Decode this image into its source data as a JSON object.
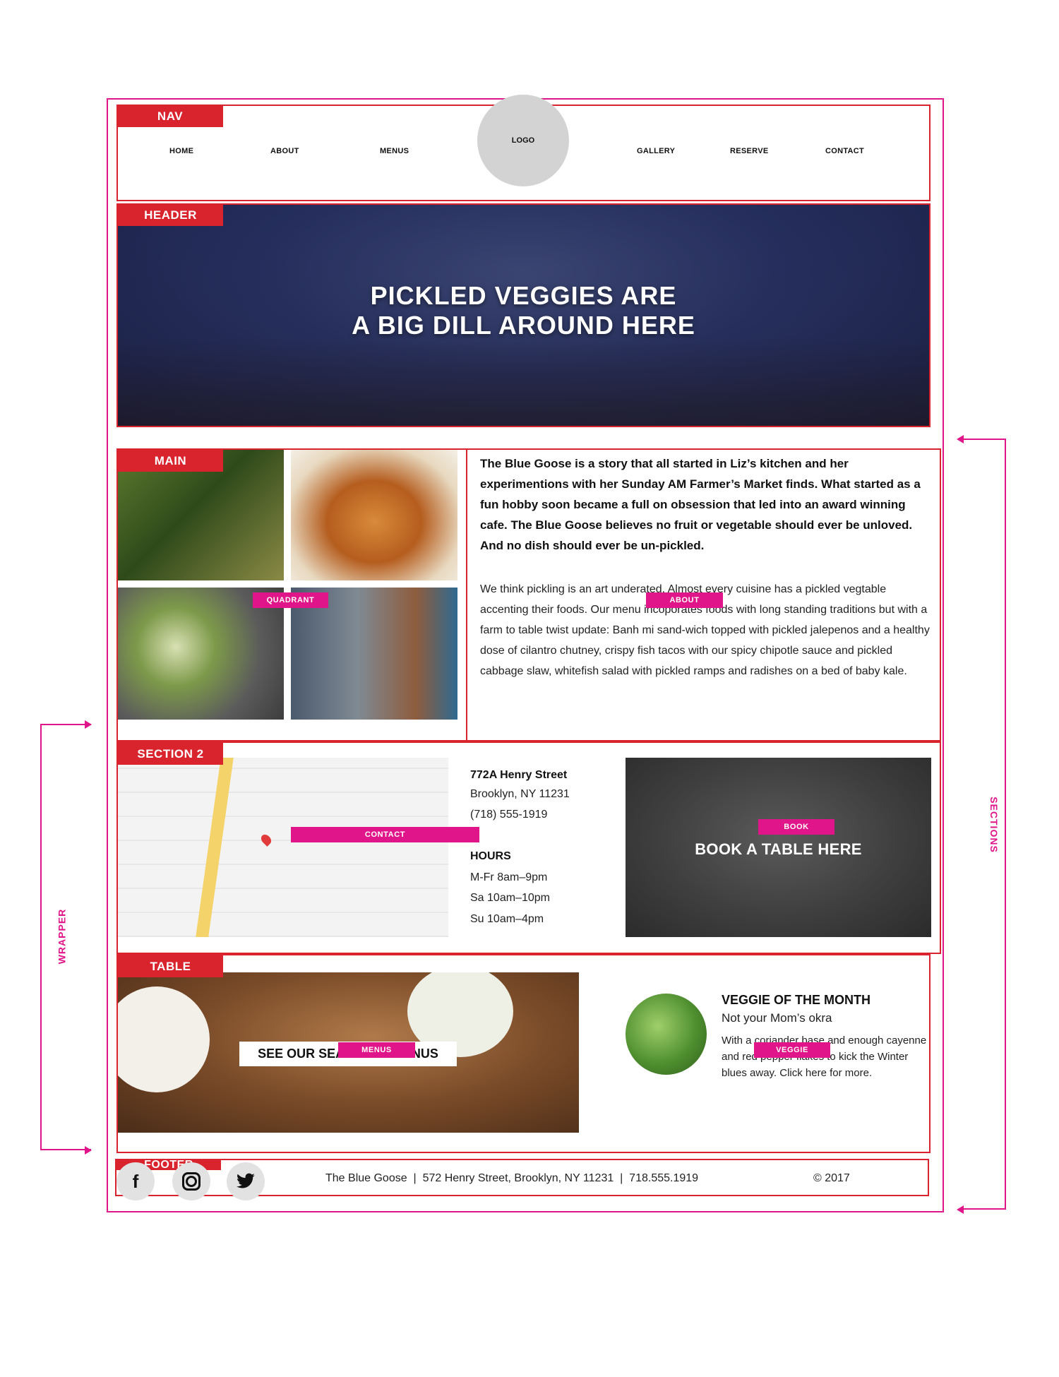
{
  "annotations": {
    "nav": "NAV",
    "header": "HEADER",
    "main": "MAIN",
    "section2": "SECTION 2",
    "table": "TABLE",
    "footer": "FOOTER",
    "wrapper": "WRAPPER",
    "sections": "SECTIONS",
    "quadrant": "QUADRANT",
    "about": "ABOUT",
    "contact": "CONTACT",
    "book": "BOOK",
    "menus": "MENUS",
    "veggie": "VEGGIE"
  },
  "nav": {
    "items": [
      "HOME",
      "ABOUT",
      "MENUS",
      "GALLERY",
      "RESERVE",
      "CONTACT"
    ],
    "logo": "LOGO"
  },
  "header": {
    "title_line1": "PICKLED VEGGIES ARE",
    "title_line2": "A BIG DILL AROUND HERE"
  },
  "about": {
    "lead": "The Blue Goose is a story that all started in Liz’s kitchen and her experimentions with her Sunday AM Farmer’s Market finds. What started as a fun hobby soon became a full on obsession that led into an award winning cafe. The Blue Goose believes no fruit or vegetable should ever be unloved. And no dish should ever be un-pickled.",
    "body": "We think pickling is an art underated. Almost every cuisine has a pickled vegtable accenting their foods. Our menu incoporates foods with long standing traditions but with a farm to table twist update: Banh mi sand-wich topped with pickled jalepenos and a healthy dose of cilantro chutney, crispy fish tacos with our spicy chipotle sauce and pickled cabbage slaw, whitefish salad with pickled ramps and radishes on a bed of baby kale."
  },
  "contact": {
    "street": "772A Henry Street",
    "city": "Brooklyn, NY 11231",
    "phone": "(718) 555-1919",
    "hours_title": "HOURS",
    "hours": [
      "M-Fr 8am–9pm",
      "Sa 10am–10pm",
      "Su 10am–4pm"
    ]
  },
  "book": {
    "label": "BOOK A TABLE HERE"
  },
  "menus": {
    "label": "SEE OUR SEASONAL MENUS"
  },
  "veggie": {
    "title": "VEGGIE OF THE MONTH",
    "subtitle": "Not your Mom’s okra",
    "text": "With a coriander base and enough cayenne and red pepper flakes to kick the Winter blues away. Click here for more."
  },
  "footer": {
    "info": "The Blue Goose  |  572 Henry Street, Brooklyn, NY 11231  |  718.555.1919",
    "copyright": "© 2017",
    "social": [
      "facebook-icon",
      "instagram-icon",
      "twitter-icon"
    ]
  },
  "colors": {
    "annotation_pink": "#e0158a",
    "section_red": "#d9232d",
    "logo_gray": "#d3d3d3"
  }
}
